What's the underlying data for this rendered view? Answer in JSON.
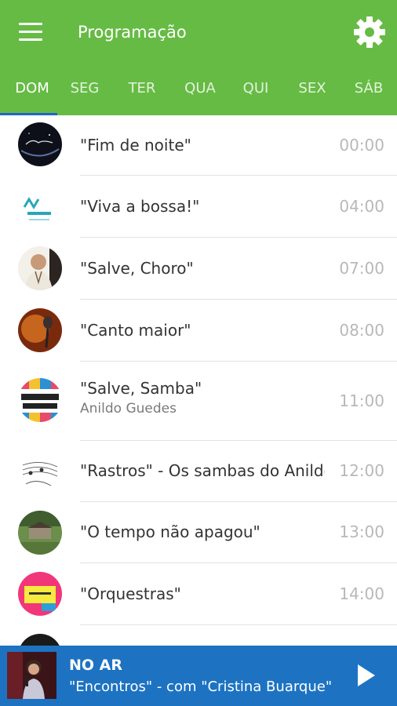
{
  "header": {
    "title": "Programação"
  },
  "tabs": [
    {
      "label": "DOM",
      "active": true
    },
    {
      "label": "SEG"
    },
    {
      "label": "TER"
    },
    {
      "label": "QUA"
    },
    {
      "label": "QUI"
    },
    {
      "label": "SEX"
    },
    {
      "label": "SÁB"
    }
  ],
  "schedule": [
    {
      "title": "\"Fim de noite\"",
      "host": "",
      "time": "00:00",
      "icon": "fim-de-noite-logo"
    },
    {
      "title": "\"Viva a bossa!\"",
      "host": "",
      "time": "04:00",
      "icon": "viva-bossa-logo"
    },
    {
      "title": "\"Salve, Choro\"",
      "host": "",
      "time": "07:00",
      "icon": "host-portrait"
    },
    {
      "title": "\"Canto maior\"",
      "host": "",
      "time": "08:00",
      "icon": "microphone-photo"
    },
    {
      "title": "\"Salve, Samba\"",
      "host": "Anildo Guedes",
      "time": "11:00",
      "icon": "salve-samba-logo"
    },
    {
      "title": "\"Rastros\" - Os sambas do Anildo",
      "host": "",
      "time": "12:00",
      "icon": "sheet-music-drawing"
    },
    {
      "title": "\"O tempo não apagou\"",
      "host": "",
      "time": "13:00",
      "icon": "house-photo"
    },
    {
      "title": "\"Orquestras\"",
      "host": "",
      "time": "14:00",
      "icon": "orquestras-logo"
    }
  ],
  "player": {
    "label": "NO AR",
    "description": "\"Encontros\" - com \"Cristina Buarque\"",
    "state": "paused"
  },
  "colors": {
    "appbar": "#66bb44",
    "tab_indicator": "#1e66c8",
    "player_bar": "#1d73c2",
    "time_text": "#b8b8b8"
  }
}
